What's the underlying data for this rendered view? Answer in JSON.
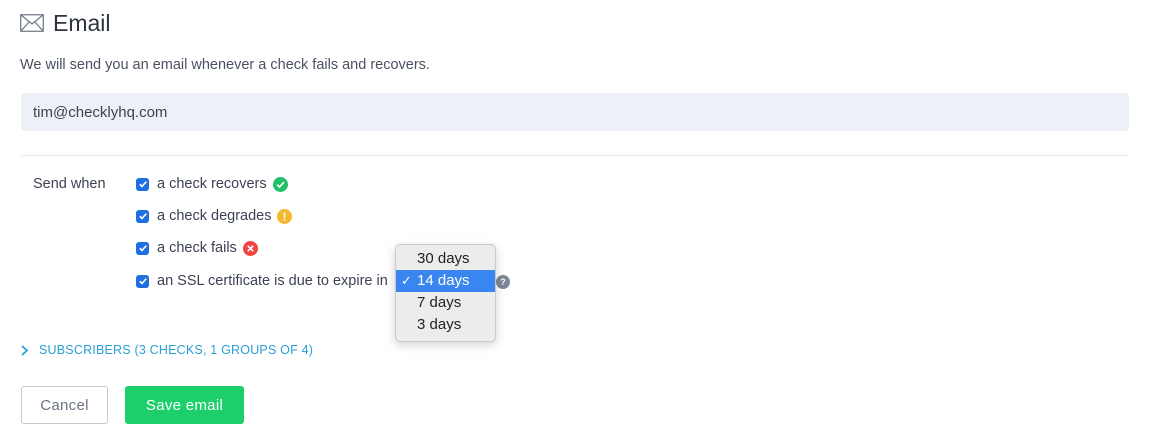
{
  "header": {
    "title": "Email",
    "icon": "mail-icon"
  },
  "description": "We will send you an email whenever a check fails and recovers.",
  "email_field": {
    "value": "tim@checklyhq.com"
  },
  "send_when": {
    "label": "Send when",
    "options": [
      {
        "label": "a check recovers",
        "checked": true,
        "status": "success",
        "color": "#20c16a"
      },
      {
        "label": "a check degrades",
        "checked": true,
        "status": "warning",
        "color": "#f5b82e"
      },
      {
        "label": "a check fails",
        "checked": true,
        "status": "error",
        "color": "#ef4444"
      },
      {
        "label": "an SSL certificate is due to expire in",
        "checked": true
      }
    ]
  },
  "ssl_dropdown": {
    "options": [
      "30 days",
      "14 days",
      "7 days",
      "3 days"
    ],
    "selected": "14 days",
    "check_mark": "✓"
  },
  "help_icon": "?",
  "subscribers": {
    "label": "SUBSCRIBERS (3 CHECKS, 1 GROUPS OF 4)"
  },
  "buttons": {
    "cancel": "Cancel",
    "save": "Save email"
  },
  "colors": {
    "accent": "#1f6fe0",
    "save": "#1ccf6a",
    "link": "#2a9fd6"
  }
}
